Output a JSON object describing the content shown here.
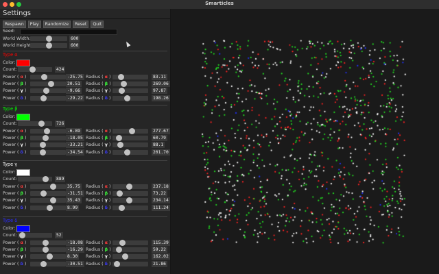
{
  "window": {
    "title": "Smarticles"
  },
  "panel": {
    "title": "Settings",
    "buttons": [
      "Respawn",
      "Play",
      "Randomize",
      "Reset",
      "Quit"
    ],
    "seed_label": "Seed:",
    "world_width": {
      "label": "World Width:",
      "value": "600",
      "fraction": 0.5
    },
    "world_height": {
      "label": "World Height:",
      "value": "600",
      "fraction": 0.5
    }
  },
  "labels": {
    "color": "Color:",
    "count": "Count:",
    "power": "Power (",
    "radius": "Radius (",
    "close": ")"
  },
  "types": [
    {
      "name": "Type α",
      "color": "#ff0000",
      "count": "424",
      "count_frac": 0.42,
      "power": [
        {
          "sym": "α",
          "sc": "#ff3b3b",
          "value": "-25.75",
          "frac": 0.37
        },
        {
          "sym": "β",
          "sc": "#3cff3c",
          "value": "20.51",
          "frac": 0.6
        },
        {
          "sym": "γ",
          "sc": "#ffffff",
          "value": "-9.66",
          "frac": 0.45
        },
        {
          "sym": "δ",
          "sc": "#3b3bff",
          "value": "-29.22",
          "frac": 0.35
        }
      ],
      "radius": [
        {
          "sym": "α",
          "sc": "#ff3b3b",
          "value": "83.11",
          "frac": 0.18
        },
        {
          "sym": "β",
          "sc": "#3cff3c",
          "value": "269.06",
          "frac": 0.27
        },
        {
          "sym": "γ",
          "sc": "#ffffff",
          "value": "97.87",
          "frac": 0.2
        },
        {
          "sym": "δ",
          "sc": "#3b3bff",
          "value": "198.26",
          "frac": 0.4
        }
      ]
    },
    {
      "name": "Type β",
      "color": "#00ff00",
      "count": "726",
      "count_frac": 0.72,
      "power": [
        {
          "sym": "α",
          "sc": "#ff3b3b",
          "value": "-6.89",
          "frac": 0.47
        },
        {
          "sym": "β",
          "sc": "#3cff3c",
          "value": "-18.05",
          "frac": 0.41
        },
        {
          "sym": "γ",
          "sc": "#ffffff",
          "value": "-33.21",
          "frac": 0.33
        },
        {
          "sym": "δ",
          "sc": "#3b3bff",
          "value": "-34.54",
          "frac": 0.33
        }
      ],
      "radius": [
        {
          "sym": "α",
          "sc": "#ff3b3b",
          "value": "277.67",
          "frac": 0.55
        },
        {
          "sym": "β",
          "sc": "#3cff3c",
          "value": "60.79",
          "frac": 0.12
        },
        {
          "sym": "γ",
          "sc": "#ffffff",
          "value": "88.1",
          "frac": 0.17
        },
        {
          "sym": "δ",
          "sc": "#3b3bff",
          "value": "201.70",
          "frac": 0.4
        }
      ]
    },
    {
      "name": "Type γ",
      "color": "#ffffff",
      "count": "889",
      "count_frac": 0.89,
      "power": [
        {
          "sym": "α",
          "sc": "#ff3b3b",
          "value": "35.75",
          "frac": 0.68
        },
        {
          "sym": "β",
          "sc": "#3cff3c",
          "value": "-31.51",
          "frac": 0.34
        },
        {
          "sym": "γ",
          "sc": "#ffffff",
          "value": "35.43",
          "frac": 0.68
        },
        {
          "sym": "δ",
          "sc": "#3b3bff",
          "value": "8.99",
          "frac": 0.55
        }
      ],
      "radius": [
        {
          "sym": "α",
          "sc": "#ff3b3b",
          "value": "237.18",
          "frac": 0.47
        },
        {
          "sym": "β",
          "sc": "#3cff3c",
          "value": "73.22",
          "frac": 0.14
        },
        {
          "sym": "γ",
          "sc": "#ffffff",
          "value": "234.14",
          "frac": 0.46
        },
        {
          "sym": "δ",
          "sc": "#3b3bff",
          "value": "111.24",
          "frac": 0.22
        }
      ]
    },
    {
      "name": "Type δ",
      "color": "#0000ff",
      "count": "52",
      "count_frac": 0.05,
      "power": [
        {
          "sym": "α",
          "sc": "#ff3b3b",
          "value": "-18.08",
          "frac": 0.41
        },
        {
          "sym": "β",
          "sc": "#3cff3c",
          "value": "-16.29",
          "frac": 0.42
        },
        {
          "sym": "γ",
          "sc": "#ffffff",
          "value": "8.30",
          "frac": 0.55
        },
        {
          "sym": "δ",
          "sc": "#3b3bff",
          "value": "-30.51",
          "frac": 0.35
        }
      ],
      "radius": [
        {
          "sym": "α",
          "sc": "#ff3b3b",
          "value": "115.39",
          "frac": 0.23
        },
        {
          "sym": "β",
          "sc": "#3cff3c",
          "value": "59.22",
          "frac": 0.12
        },
        {
          "sym": "γ",
          "sc": "#ffffff",
          "value": "162.02",
          "frac": 0.32
        },
        {
          "sym": "δ",
          "sc": "#3b3bff",
          "value": "21.86",
          "frac": 0.04
        }
      ]
    }
  ],
  "simulation": {
    "particle_colors": [
      "#ff2222",
      "#22dd22",
      "#ffffff",
      "#2233ff"
    ],
    "particle_counts": [
      424,
      726,
      889,
      52
    ]
  }
}
